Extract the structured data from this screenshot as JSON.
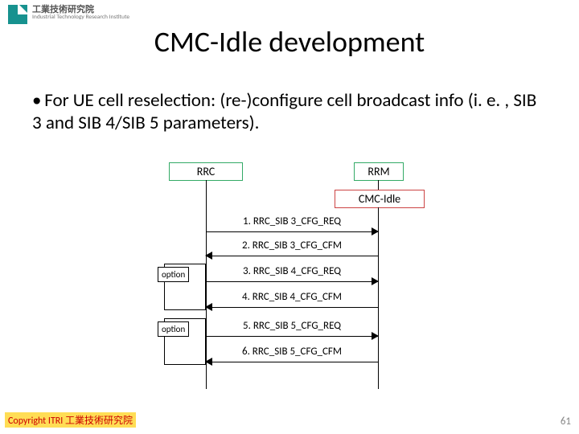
{
  "header": {
    "org_main": "工業技術研究院",
    "org_sub": "Industrial Technology\nResearch Institute"
  },
  "title": "CMC-Idle development",
  "bullet": "For UE cell reselection: (re-)configure cell broadcast info (i. e. , SIB 3 and SIB 4/SIB 5 parameters).",
  "diagram": {
    "actor_left": "RRC",
    "actor_right": "RRM",
    "create_box": "CMC-Idle",
    "opt_label": "option",
    "messages": [
      "1. RRC_SIB 3_CFG_REQ",
      "2. RRC_SIB 3_CFG_CFM",
      "3. RRC_SIB 4_CFG_REQ",
      "4. RRC_SIB 4_CFG_CFM",
      "5. RRC_SIB 5_CFG_REQ",
      "6. RRC_SIB 5_CFG_CFM"
    ]
  },
  "footer": {
    "copyright": "Copyright  ITRI  工業技術研究院",
    "slide_number": "61"
  }
}
